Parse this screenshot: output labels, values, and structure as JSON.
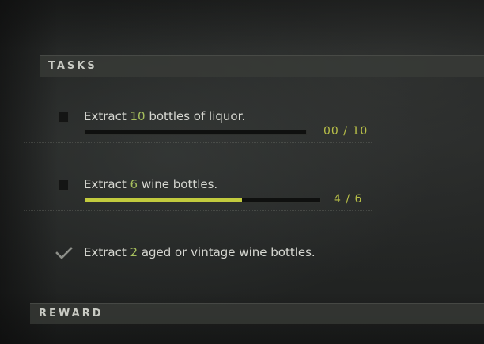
{
  "headers": {
    "tasks": "TASKS",
    "reward": "REWARD"
  },
  "tasks": [
    {
      "prefix": "Extract ",
      "number": "10",
      "suffix": " bottles of liquor.",
      "completed": false,
      "progress_text": "00 / 10",
      "progress_fraction": 0.0
    },
    {
      "prefix": "Extract ",
      "number": "6",
      "suffix": " wine bottles.",
      "completed": false,
      "progress_text": "4 / 6",
      "progress_fraction": 0.667
    },
    {
      "prefix": "Extract ",
      "number": "2",
      "suffix": " aged or vintage wine bottles.",
      "completed": true
    }
  ],
  "colors": {
    "highlight_number": "#a6bf5d",
    "progress_fill": "#c2cb3e",
    "progress_text": "#b9c048"
  },
  "icons": {
    "checkbox": "checkbox-empty-icon",
    "completed": "checkmark-icon"
  }
}
